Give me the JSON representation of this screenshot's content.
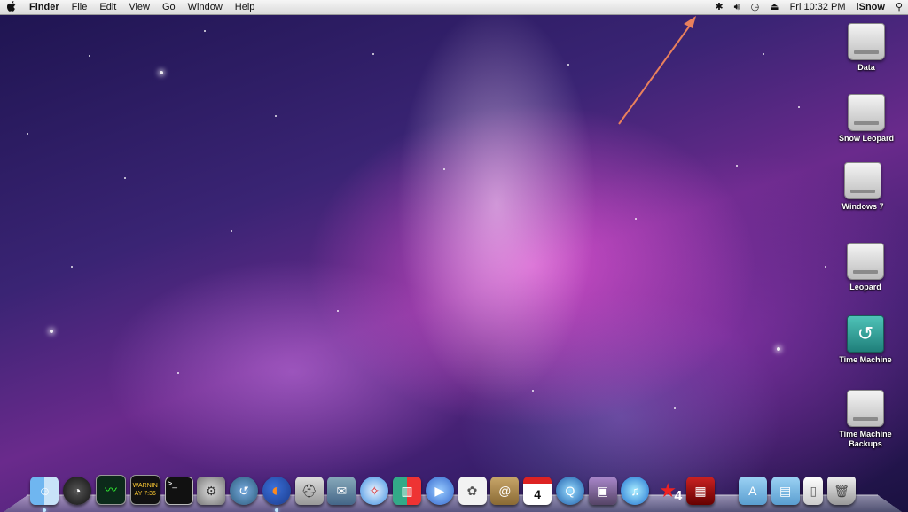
{
  "menubar": {
    "apple": "",
    "items": [
      "Finder",
      "File",
      "Edit",
      "View",
      "Go",
      "Window",
      "Help"
    ],
    "clock": "Fri 10:32 PM",
    "user": "iSnow"
  },
  "desktop_icons": [
    "Data",
    "Snow Leopard",
    "Windows 7",
    "Leopard",
    "Time Machine",
    "Time Machine Backups"
  ],
  "dock": {
    "activity_text": "WARNIN",
    "activity_text2": "AY 7:36",
    "terminal_text": ">_",
    "calendar_day": "4",
    "badge_text": "4"
  }
}
